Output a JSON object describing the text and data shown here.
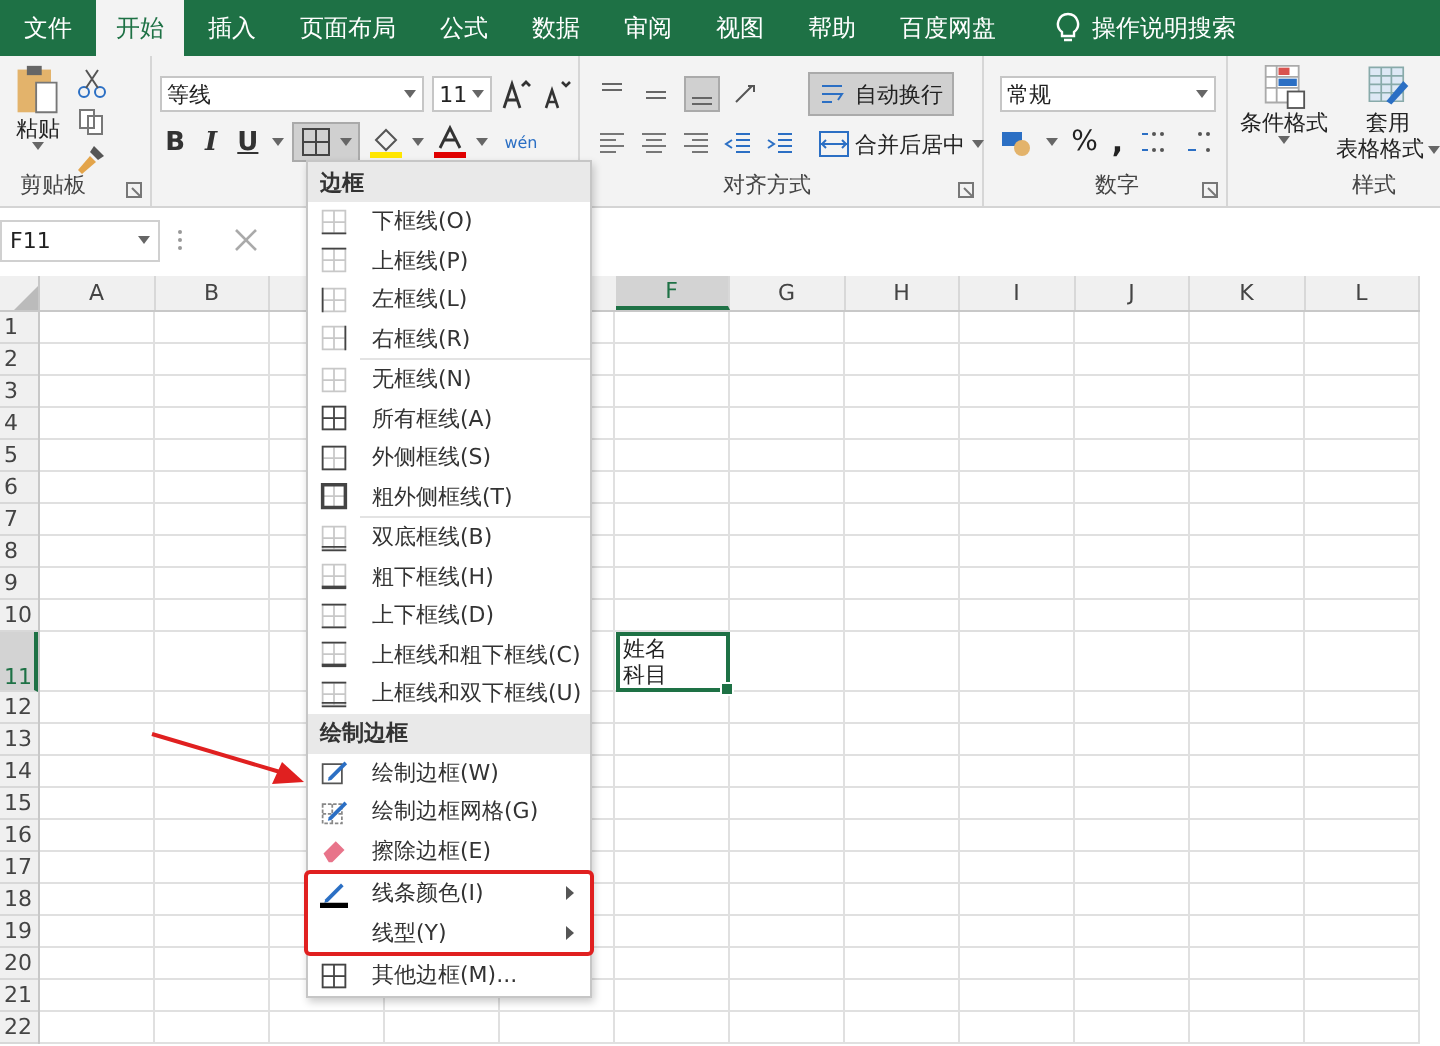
{
  "tabs": [
    {
      "label": "文件",
      "selected": false
    },
    {
      "label": "开始",
      "selected": true
    },
    {
      "label": "插入",
      "selected": false
    },
    {
      "label": "页面布局",
      "selected": false
    },
    {
      "label": "公式",
      "selected": false
    },
    {
      "label": "数据",
      "selected": false
    },
    {
      "label": "审阅",
      "selected": false
    },
    {
      "label": "视图",
      "selected": false
    },
    {
      "label": "帮助",
      "selected": false
    },
    {
      "label": "百度网盘",
      "selected": false
    }
  ],
  "tell_me": "操作说明搜索",
  "ribbon": {
    "clipboard": {
      "paste": "粘贴",
      "label": "剪贴板"
    },
    "font": {
      "name": "等线",
      "size": "11",
      "bold": "B",
      "italic": "I",
      "underline": "U",
      "phonetic": "wén"
    },
    "alignment": {
      "wrap": "自动换行",
      "wrap_on": true,
      "merge": "合并后居中",
      "label": "对齐方式"
    },
    "number": {
      "format": "常规",
      "percent": "%",
      "comma": ",",
      "label": "数字"
    },
    "styles": {
      "conditional": "条件格式",
      "table_1": "套用",
      "table_2": "表格格式",
      "label": "样式"
    }
  },
  "name_box": "F11",
  "columns": [
    {
      "label": "A",
      "selected": false
    },
    {
      "label": "B",
      "selected": false
    },
    {
      "label": "F",
      "selected": true
    },
    {
      "label": "G",
      "selected": false
    },
    {
      "label": "H",
      "selected": false
    },
    {
      "label": "I",
      "selected": false
    },
    {
      "label": "J",
      "selected": false
    },
    {
      "label": "K",
      "selected": false
    },
    {
      "label": "L",
      "selected": false
    }
  ],
  "rows": [
    {
      "label": "1",
      "selected": false
    },
    {
      "label": "2",
      "selected": false
    },
    {
      "label": "3",
      "selected": false
    },
    {
      "label": "4",
      "selected": false
    },
    {
      "label": "5",
      "selected": false
    },
    {
      "label": "6",
      "selected": false
    },
    {
      "label": "7",
      "selected": false
    },
    {
      "label": "8",
      "selected": false
    },
    {
      "label": "9",
      "selected": false
    },
    {
      "label": "10",
      "selected": false
    },
    {
      "label": "11",
      "selected": true
    },
    {
      "label": "12",
      "selected": false
    },
    {
      "label": "13",
      "selected": false
    },
    {
      "label": "14",
      "selected": false
    },
    {
      "label": "15",
      "selected": false
    },
    {
      "label": "16",
      "selected": false
    },
    {
      "label": "17",
      "selected": false
    },
    {
      "label": "18",
      "selected": false
    },
    {
      "label": "19",
      "selected": false
    },
    {
      "label": "20",
      "selected": false
    },
    {
      "label": "21",
      "selected": false
    },
    {
      "label": "22",
      "selected": false
    }
  ],
  "active_cell": {
    "lines": [
      "姓名",
      "科目"
    ]
  },
  "menu": {
    "sections": [
      {
        "title": "边框",
        "groups": [
          [
            {
              "label": "下框线(O)",
              "kind": "bottom"
            },
            {
              "label": "上框线(P)",
              "kind": "top"
            },
            {
              "label": "左框线(L)",
              "kind": "left"
            },
            {
              "label": "右框线(R)",
              "kind": "right"
            }
          ],
          [
            {
              "label": "无框线(N)",
              "kind": "none"
            },
            {
              "label": "所有框线(A)",
              "kind": "all"
            },
            {
              "label": "外侧框线(S)",
              "kind": "outside"
            },
            {
              "label": "粗外侧框线(T)",
              "kind": "thick"
            }
          ],
          [
            {
              "label": "双底框线(B)",
              "kind": "double"
            },
            {
              "label": "粗下框线(H)",
              "kind": "thickbottom"
            },
            {
              "label": "上下框线(D)",
              "kind": "topbottom"
            },
            {
              "label": "上框线和粗下框线(C)",
              "kind": "topthick"
            },
            {
              "label": "上框线和双下框线(U)",
              "kind": "topdouble"
            }
          ]
        ]
      },
      {
        "title": "绘制边框",
        "groups": [
          [
            {
              "label": "绘制边框(W)",
              "kind": "draw",
              "highlighted": false,
              "submenu": false
            },
            {
              "label": "绘制边框网格(G)",
              "kind": "grid",
              "highlighted": false,
              "submenu": false
            },
            {
              "label": "擦除边框(E)",
              "kind": "erase",
              "highlighted": false,
              "submenu": false
            },
            {
              "label": "线条颜色(I)",
              "kind": "color",
              "highlighted": true,
              "submenu": true
            },
            {
              "label": "线型(Y)",
              "kind": "style",
              "highlighted": true,
              "submenu": true
            },
            {
              "label": "其他边框(M)...",
              "kind": "all",
              "highlighted": false,
              "submenu": false
            }
          ]
        ]
      }
    ]
  }
}
